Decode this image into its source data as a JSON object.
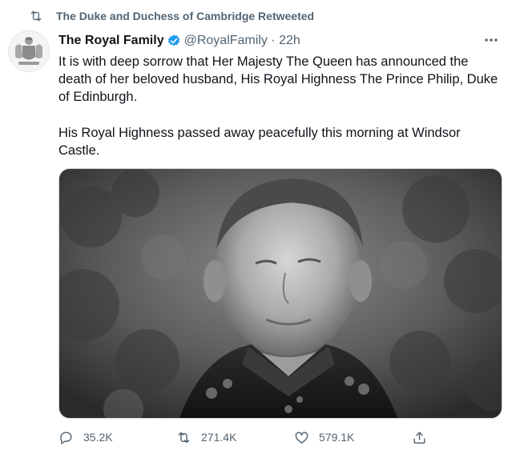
{
  "retweet_banner": {
    "icon": "retweet-icon",
    "label": "The Duke and Duchess of Cambridge Retweeted"
  },
  "tweet": {
    "avatar": "royal-coat-of-arms-avatar",
    "author_name": "The Royal Family",
    "verified": true,
    "handle": "@RoyalFamily",
    "separator": " · ",
    "time": "22h",
    "paragraphs": [
      "It is with deep sorrow that Her Majesty The Queen has announced the death of her beloved husband, His Royal Highness The Prince Philip, Duke of Edinburgh.",
      "His Royal Highness passed away peacefully this morning at Windsor Castle."
    ],
    "media": "black-and-white-portrait-photo"
  },
  "actions": {
    "replies": "35.2K",
    "retweets": "271.4K",
    "likes": "579.1K"
  },
  "colors": {
    "text": "#0f1419",
    "muted": "#536471",
    "verified": "#1d9bf0",
    "border": "#cfd9de"
  }
}
